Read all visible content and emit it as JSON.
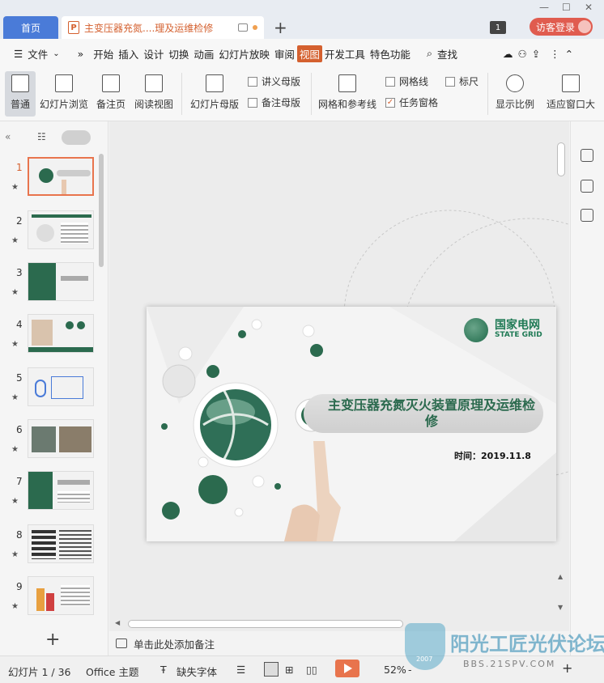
{
  "titlebar": {
    "home_tab": "首页",
    "doc_tab": "主变压器充氮....理及运维检修",
    "doc_icon": "P",
    "new_tab": "+",
    "badge": "1",
    "login": "访客登录"
  },
  "menu": {
    "file": "文件",
    "items": [
      "开始",
      "插入",
      "设计",
      "切换",
      "动画",
      "幻灯片放映",
      "审阅",
      "视图",
      "开发工具",
      "特色功能"
    ],
    "active": "视图",
    "search": "查找"
  },
  "ribbon": {
    "normal": "普通",
    "slide_browse": "幻灯片浏览",
    "notes_page": "备注页",
    "reading_view": "阅读视图",
    "slide_master": "幻灯片母版",
    "handout_master": "讲义母版",
    "notes_master": "备注母版",
    "grid_guides": "网格和参考线",
    "gridlines": "网格线",
    "ruler": "标尺",
    "task_pane": "任务窗格",
    "zoom": "显示比例",
    "fit_window": "适应窗口大"
  },
  "thumbnails": [
    "1",
    "2",
    "3",
    "4",
    "5",
    "6",
    "7",
    "8",
    "9"
  ],
  "slide": {
    "title": "主变压器充氮灭火装置原理及运维检修",
    "date": "时间：2019.11.8",
    "logo_cn": "国家电网",
    "logo_en": "STATE GRID"
  },
  "notes": {
    "placeholder": "单击此处添加备注"
  },
  "status": {
    "slide_counter": "幻灯片 1 / 36",
    "theme": "Office 主题",
    "missing_fonts": "缺失字体",
    "zoom": "52%",
    "minus": "-",
    "plus": "+"
  },
  "watermark": {
    "title": "阳光工匠光伏论坛",
    "url": "BBS.21SPV.COM",
    "year": "2007"
  },
  "colors": {
    "accent": "#d4602f",
    "home_tab": "#4a7bd8",
    "login": "#e05c4f",
    "brand_green": "#1f7a55"
  }
}
